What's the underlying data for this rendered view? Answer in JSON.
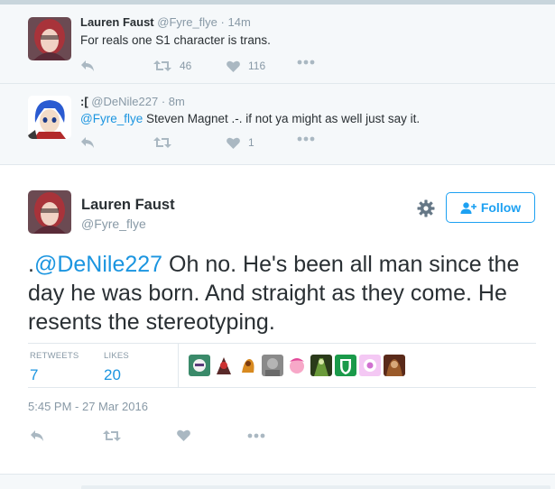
{
  "replies": [
    {
      "name": "Lauren Faust",
      "handle": "@Fyre_flye",
      "separator": "·",
      "time": "14m",
      "text": "For reals one S1 character is trans.",
      "retweets": "46",
      "likes": "116"
    },
    {
      "name": ":[",
      "handle": "@DeNile227",
      "separator": "·",
      "time": "8m",
      "mention": "@Fyre_flye",
      "text": " Steven Magnet .-. if not ya might as well just say it.",
      "retweets": "",
      "likes": "1"
    }
  ],
  "main": {
    "name": "Lauren Faust",
    "handle": "@Fyre_flye",
    "follow_label": "Follow",
    "text_prefix": ".",
    "mention": "@DeNile227",
    "text": " Oh no.  He's been all man since the day he was born.  And straight as they come.  He resents the stereotyping.",
    "stats": {
      "retweets_label": "RETWEETS",
      "retweets": "7",
      "likes_label": "LIKES",
      "likes": "20"
    },
    "timestamp": "5:45 PM - 27 Mar 2016"
  },
  "colors": {
    "accent": "#1da1f2",
    "link": "#1b95e0",
    "muted": "#8899a6",
    "icon": "#aab8c2"
  },
  "icons": [
    "reply-icon",
    "retweet-icon",
    "like-icon",
    "more-icon",
    "gear-icon",
    "follow-person-icon"
  ]
}
